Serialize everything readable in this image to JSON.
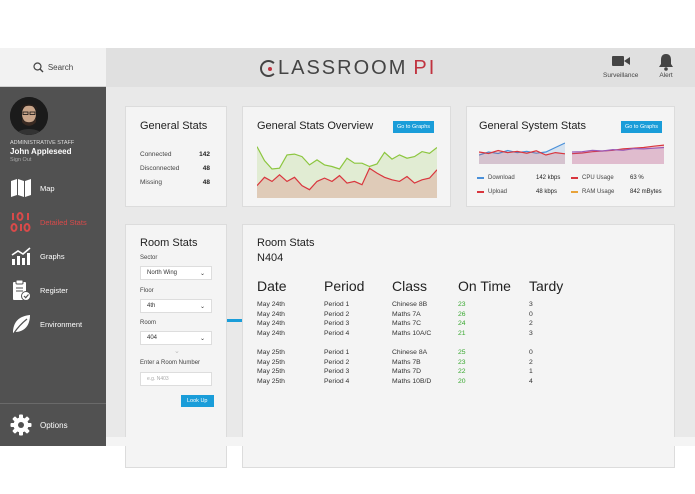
{
  "search": {
    "label": "Search"
  },
  "app": {
    "logo_main": "LASSROOM",
    "logo_accent": "PI"
  },
  "topbar": {
    "surveillance_label": "Surveillance",
    "alert_label": "Alert"
  },
  "user": {
    "role": "ADMINISTRATIVE STAFF",
    "name": "John Appleseed",
    "signout": "Sign Out"
  },
  "nav": {
    "items": [
      {
        "label": "Map",
        "icon": "map-icon"
      },
      {
        "label": "Detailed Stats",
        "icon": "binary-icon"
      },
      {
        "label": "Graphs",
        "icon": "chart-icon"
      },
      {
        "label": "Register",
        "icon": "clipboard-icon"
      },
      {
        "label": "Environment",
        "icon": "leaf-icon"
      }
    ],
    "active": "Detailed Stats",
    "options_label": "Options"
  },
  "general_stats": {
    "title": "General Stats",
    "rows": [
      {
        "label": "Connected",
        "value": "142"
      },
      {
        "label": "Disconnected",
        "value": "48"
      },
      {
        "label": "Missing",
        "value": "48"
      }
    ]
  },
  "overview": {
    "title": "General Stats Overview",
    "button": "Go to Graphs",
    "series": [
      {
        "color": "#8cc63f",
        "values": [
          62,
          45,
          35,
          36,
          52,
          53,
          50,
          40,
          46,
          40,
          38,
          35,
          48,
          42,
          42,
          38,
          41,
          55,
          47,
          52,
          48,
          50,
          56,
          54,
          61
        ]
      },
      {
        "color": "#d9363e",
        "values": [
          15,
          25,
          20,
          28,
          20,
          25,
          15,
          10,
          20,
          24,
          20,
          27,
          18,
          20,
          16,
          36,
          30,
          25,
          22,
          20,
          26,
          18,
          22,
          24,
          34
        ]
      }
    ]
  },
  "system_stats": {
    "title": "General System Stats",
    "button": "Go to Graphs",
    "chart1": [
      {
        "color": "#4a90d9",
        "values": [
          30,
          40,
          35,
          45,
          38,
          42,
          36,
          40,
          55,
          70
        ]
      },
      {
        "color": "#d9363e",
        "values": [
          40,
          35,
          45,
          38,
          42,
          36,
          44,
          30,
          38,
          34
        ]
      }
    ],
    "chart2": [
      {
        "color": "#d9363e",
        "values": [
          30,
          32,
          36,
          38,
          40,
          44,
          46,
          48,
          52,
          55
        ]
      },
      {
        "color": "#9b59b6",
        "values": [
          35,
          36,
          40,
          38,
          42,
          40,
          45,
          44,
          46,
          48
        ]
      }
    ],
    "rows": [
      {
        "label": "Download",
        "value": "142 kbps",
        "color": "#4a90d9"
      },
      {
        "label": "Upload",
        "value": "48 kbps",
        "color": "#d9363e"
      },
      {
        "label": "CPU Usage",
        "value": "63 %",
        "color": "#d9363e"
      },
      {
        "label": "RAM Usage",
        "value": "842 mBytes",
        "color": "#e8a33a"
      }
    ]
  },
  "room_stats": {
    "title": "Room Stats",
    "sector_label": "Sector",
    "sector_value": "North Wing",
    "floor_label": "Floor",
    "floor_value": "4th",
    "room_label": "Room",
    "room_value": "404",
    "room_number_label": "Enter a Room Number",
    "room_number_placeholder": "e.g. N403",
    "lookup_button": "Look Up"
  },
  "room_detail": {
    "title": "Room Stats",
    "room": "N404",
    "headers": [
      "Date",
      "Period",
      "Class",
      "On Time",
      "Tardy"
    ],
    "rows": [
      [
        "May 24th",
        "Period 1",
        "Chinese 8B",
        "23",
        "3"
      ],
      [
        "May 24th",
        "Period 2",
        "Maths 7A",
        "26",
        "0"
      ],
      [
        "May 24th",
        "Period 3",
        "Maths 7C",
        "24",
        "2"
      ],
      [
        "May 24th",
        "Period 4",
        "Maths 10A/C",
        "21",
        "3"
      ],
      [
        "May 25th",
        "Period 1",
        "Chinese 8A",
        "25",
        "0"
      ],
      [
        "May 25th",
        "Period 2",
        "Maths 7B",
        "23",
        "2"
      ],
      [
        "May 25th",
        "Period 3",
        "Maths 7D",
        "22",
        "1"
      ],
      [
        "May 25th",
        "Period 4",
        "Maths 10B/D",
        "20",
        "4"
      ]
    ]
  }
}
